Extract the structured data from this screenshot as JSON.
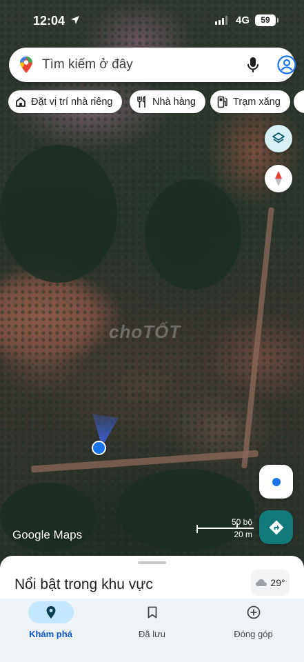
{
  "status_bar": {
    "time": "12:04",
    "network": "4G",
    "battery": "59"
  },
  "search": {
    "placeholder": "Tìm kiếm ở đây"
  },
  "chips": [
    {
      "label": "Đặt vị trí nhà riêng",
      "icon": "home-icon"
    },
    {
      "label": "Nhà hàng",
      "icon": "restaurant-icon"
    },
    {
      "label": "Trạm xăng",
      "icon": "gas-station-icon"
    }
  ],
  "map": {
    "watermark": "choTỐT",
    "logo": "Google Maps",
    "scale_imperial": "50 bộ",
    "scale_metric": "20 m"
  },
  "sheet": {
    "title": "Nổi bật trong khu vực",
    "weather_temp": "29°"
  },
  "nav": [
    {
      "label": "Khám phá",
      "icon": "explore-pin-icon",
      "active": true
    },
    {
      "label": "Đã lưu",
      "icon": "bookmark-icon",
      "active": false
    },
    {
      "label": "Đóng góp",
      "icon": "add-circle-icon",
      "active": false
    }
  ],
  "colors": {
    "accent": "#1a73e8",
    "directions": "#137a7a",
    "active_nav_pill": "#c2e7ff"
  }
}
